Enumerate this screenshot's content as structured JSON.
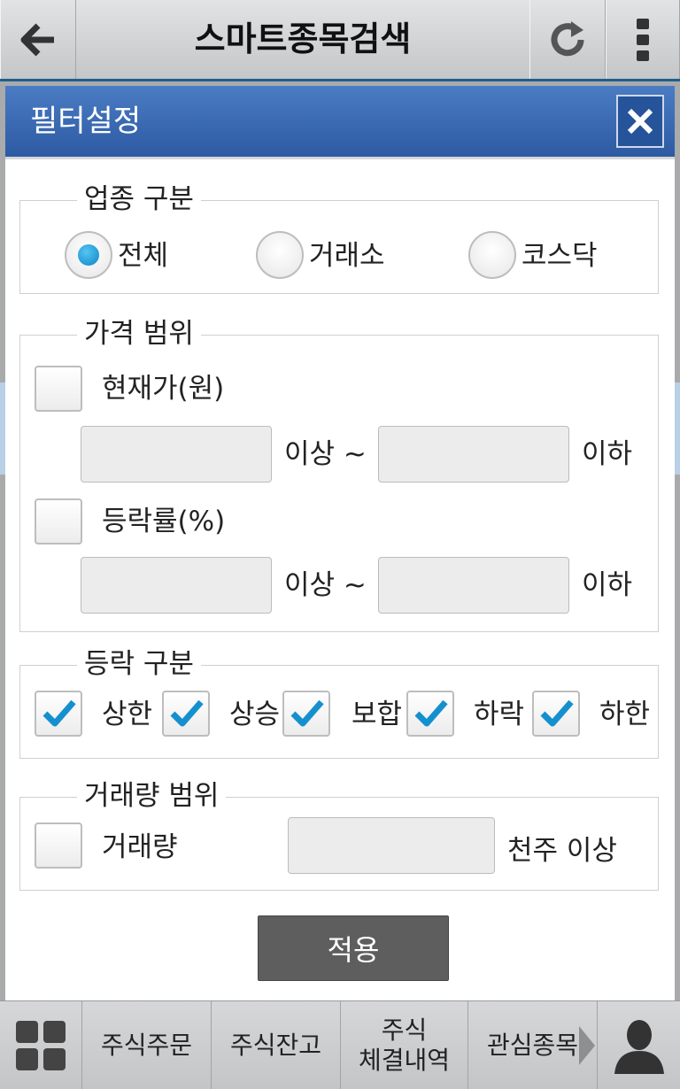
{
  "appbar": {
    "title": "스마트종목검색",
    "back_icon": "arrow-left-icon",
    "refresh_icon": "refresh-icon",
    "menu_icon": "more-vertical-icon"
  },
  "dialog": {
    "title": "필터설정",
    "close_icon": "close-icon",
    "sector": {
      "legend": "업종 구분",
      "options": [
        "전체",
        "거래소",
        "코스닥"
      ],
      "selected": "전체"
    },
    "price_range": {
      "legend": "가격 범위",
      "current_price": {
        "label": "현재가(원)",
        "checked": false,
        "min_value": "",
        "max_value": "",
        "above_label": "이상 ~",
        "below_label": "이하"
      },
      "change_rate": {
        "label": "등락률(%)",
        "checked": false,
        "min_value": "",
        "max_value": "",
        "above_label": "이상 ~",
        "below_label": "이하"
      }
    },
    "change_type": {
      "legend": "등락 구분",
      "options": [
        {
          "label": "상한",
          "checked": true
        },
        {
          "label": "상승",
          "checked": true
        },
        {
          "label": "보합",
          "checked": true
        },
        {
          "label": "하락",
          "checked": true
        },
        {
          "label": "하한",
          "checked": true
        }
      ]
    },
    "volume_range": {
      "legend": "거래량 범위",
      "label": "거래량",
      "checked": false,
      "value": "",
      "unit_label": "천주 이상"
    },
    "apply_label": "적용"
  },
  "bottom_nav": {
    "home_icon": "grid-icon",
    "items": [
      "주식주문",
      "주식잔고",
      "주식",
      "체결내역",
      "관심종목"
    ],
    "user_icon": "user-icon"
  },
  "colors": {
    "dialog_header": "#3a6ab4",
    "accent_blue": "#1e8fd0",
    "apply_button": "#5e5e5e"
  }
}
